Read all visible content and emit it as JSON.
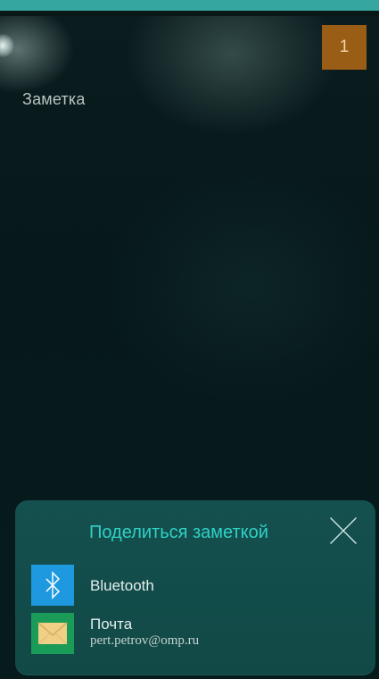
{
  "header": {
    "counter": "1",
    "note_title": "Заметка"
  },
  "share_panel": {
    "title": "Поделиться заметкой",
    "close_icon": "close-icon",
    "items": [
      {
        "label": "Bluetooth",
        "icon": "bluetooth-icon"
      },
      {
        "label": "Почта",
        "subtitle": "pert.petrov@omp.ru",
        "icon": "mail-icon"
      }
    ]
  },
  "colors": {
    "accent_top": "#35a7a0",
    "badge": "#9a5d15",
    "panel": "#14504f",
    "title_accent": "#2fd1c4",
    "bluetooth": "#1e98de",
    "mail_frame": "#1a9b58",
    "mail_envelope": "#f0cf86"
  }
}
